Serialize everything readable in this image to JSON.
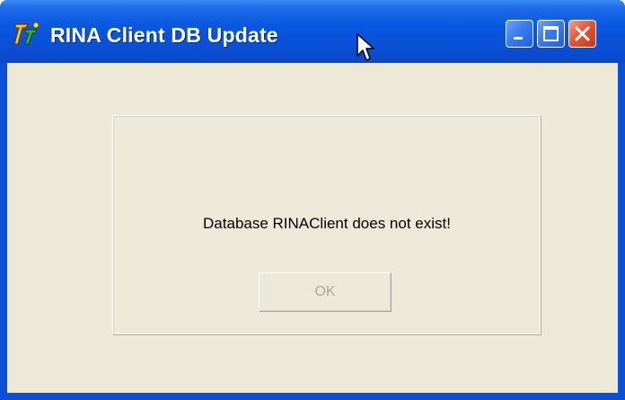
{
  "window": {
    "title": "RINA Client DB Update",
    "icon": "app-logo-icon",
    "controls": [
      "minimize-icon",
      "maximize-icon",
      "close-icon"
    ]
  },
  "dialog": {
    "message": "Database RINAClient does not exist!",
    "ok_label": "OK",
    "ok_enabled": false
  },
  "colors": {
    "titlebar": "#0a54dc",
    "client_bg": "#ece9d8",
    "close_button": "#e04a2a",
    "disabled_text": "#aca899"
  }
}
